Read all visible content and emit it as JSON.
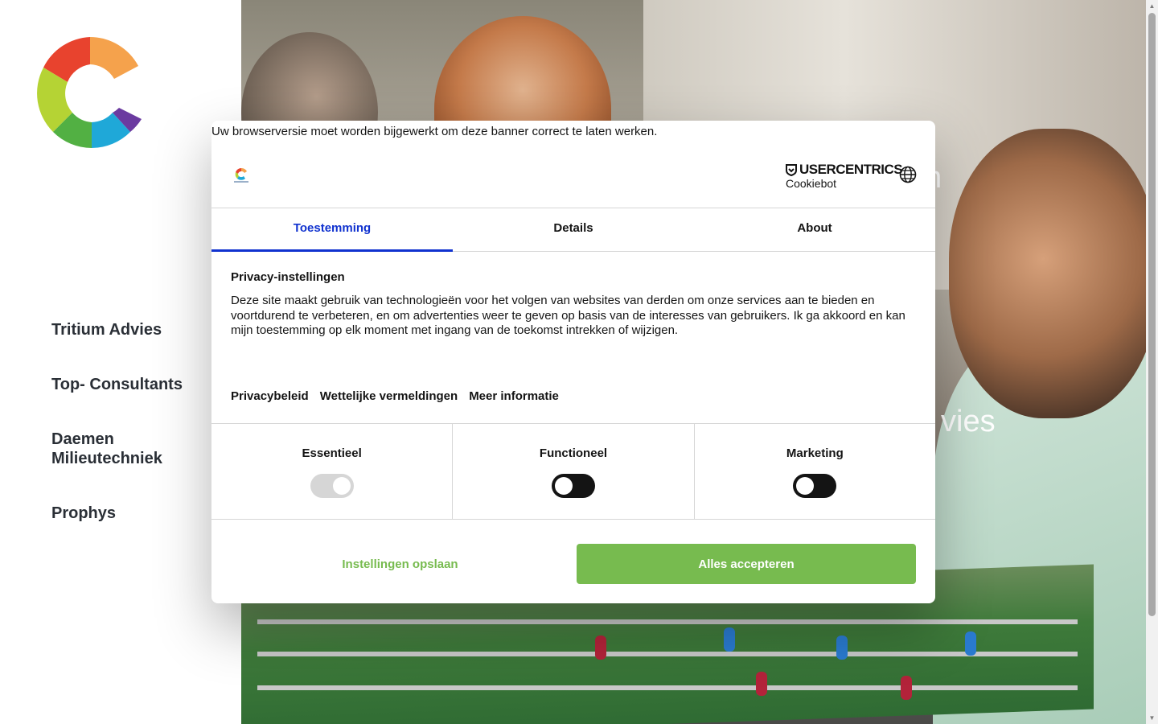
{
  "sidebar": {
    "nav": [
      {
        "label": "Tritium Advies"
      },
      {
        "label": "Top- Consultants"
      },
      {
        "label": "Daemen Milieutechniek"
      },
      {
        "label": "Prophys"
      }
    ]
  },
  "hero": {
    "partial_text_1": "n",
    "partial_text_2": "vies"
  },
  "dialog": {
    "warning": "Uw browserversie moet worden bijgewerkt om deze banner correct te laten werken.",
    "brand_top": "USERCENTRICS",
    "brand_bottom": "Cookiebot",
    "tabs": [
      {
        "label": "Toestemming",
        "active": true
      },
      {
        "label": "Details",
        "active": false
      },
      {
        "label": "About",
        "active": false
      }
    ],
    "heading": "Privacy-instellingen",
    "description": "Deze site maakt gebruik van technologieën voor het volgen van websites van derden om onze services aan te bieden en voortdurend te verbeteren, en om advertenties weer te geven op basis van de interesses van gebruikers. Ik ga akkoord en kan mijn toestemming op elk moment met ingang van de toekomst intrekken of wijzigen.",
    "links": [
      "Privacybeleid",
      "Wettelijke vermeldingen",
      "Meer informatie"
    ],
    "toggles": [
      {
        "label": "Essentieel",
        "on": true,
        "disabled": true
      },
      {
        "label": "Functioneel",
        "on": false,
        "disabled": false
      },
      {
        "label": "Marketing",
        "on": false,
        "disabled": false
      }
    ],
    "save_label": "Instellingen opslaan",
    "accept_label": "Alles accepteren",
    "accent": "#1032cf",
    "button_color": "#77bb4f"
  }
}
